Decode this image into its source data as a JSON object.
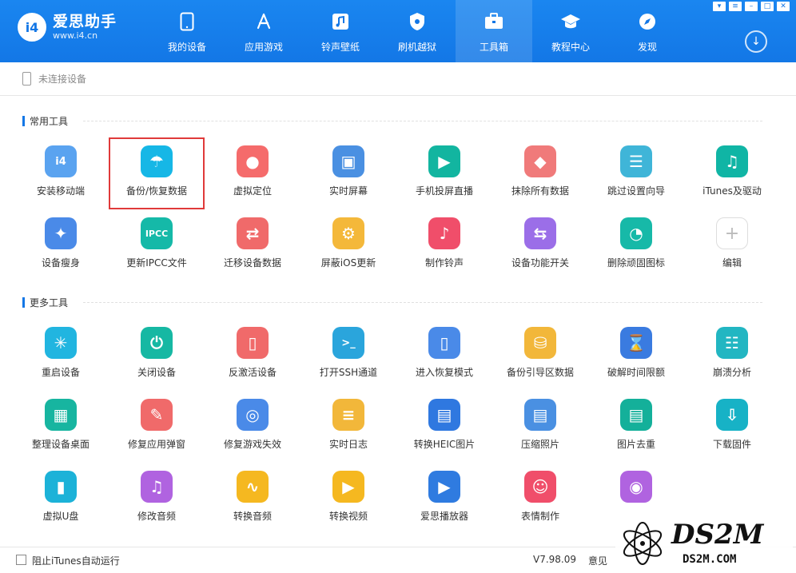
{
  "app": {
    "logo_mark": "i4",
    "logo_title": "爱思助手",
    "logo_url": "www.i4.cn"
  },
  "nav": [
    {
      "label": "我的设备",
      "icon": "phone-icon"
    },
    {
      "label": "应用游戏",
      "icon": "app-store-icon"
    },
    {
      "label": "铃声壁纸",
      "icon": "music-icon"
    },
    {
      "label": "刷机越狱",
      "icon": "shield-icon"
    },
    {
      "label": "工具箱",
      "icon": "toolbox-icon",
      "active": true
    },
    {
      "label": "教程中心",
      "icon": "graduation-cap-icon"
    },
    {
      "label": "发现",
      "icon": "compass-icon"
    }
  ],
  "device": {
    "status": "未连接设备"
  },
  "sections": {
    "common": "常用工具",
    "more": "更多工具"
  },
  "common_tools": [
    {
      "label": "安装移动端",
      "color": "#5aa3f0",
      "glyph": "i4"
    },
    {
      "label": "备份/恢复数据",
      "color": "#16b7e6",
      "glyph": "☂"
    },
    {
      "label": "虚拟定位",
      "color": "#f56b6b",
      "glyph": "●"
    },
    {
      "label": "实时屏幕",
      "color": "#4a90e2",
      "glyph": "▣"
    },
    {
      "label": "手机投屏直播",
      "color": "#12b5a0",
      "glyph": "▶"
    },
    {
      "label": "抹除所有数据",
      "color": "#f07a7a",
      "glyph": "◆"
    },
    {
      "label": "跳过设置向导",
      "color": "#3fb5d8",
      "glyph": "☰"
    },
    {
      "label": "iTunes及驱动",
      "color": "#10b5a5",
      "glyph": "♫"
    },
    {
      "label": "设备瘦身",
      "color": "#4a8ae8",
      "glyph": "✦"
    },
    {
      "label": "更新IPCC文件",
      "color": "#15b9a8",
      "glyph": "IPCC"
    },
    {
      "label": "迁移设备数据",
      "color": "#f06a6a",
      "glyph": "⇄"
    },
    {
      "label": "屏蔽iOS更新",
      "color": "#f4b83a",
      "glyph": "⚙"
    },
    {
      "label": "制作铃声",
      "color": "#f04e6a",
      "glyph": "♪"
    },
    {
      "label": "设备功能开关",
      "color": "#9b6ee8",
      "glyph": "⇆"
    },
    {
      "label": "删除顽固图标",
      "color": "#17b9a8",
      "glyph": "◔"
    },
    {
      "label": "编辑",
      "color": "#ffffff",
      "glyph": "+"
    }
  ],
  "more_tools": [
    {
      "label": "重启设备",
      "color": "#21b5e0",
      "glyph": "✳"
    },
    {
      "label": "关闭设备",
      "color": "#16b8a3",
      "glyph": "⏻"
    },
    {
      "label": "反激活设备",
      "color": "#f06a6a",
      "glyph": "▯"
    },
    {
      "label": "打开SSH通道",
      "color": "#2aa5dc",
      "glyph": ">_"
    },
    {
      "label": "进入恢复模式",
      "color": "#4a8ae8",
      "glyph": "▯"
    },
    {
      "label": "备份引导区数据",
      "color": "#f2b73a",
      "glyph": "⛁"
    },
    {
      "label": "破解时间限额",
      "color": "#3a7be0",
      "glyph": "⌛"
    },
    {
      "label": "崩溃分析",
      "color": "#22b6c2",
      "glyph": "☷"
    },
    {
      "label": "整理设备桌面",
      "color": "#17b5a0",
      "glyph": "▦"
    },
    {
      "label": "修复应用弹窗",
      "color": "#f06a6a",
      "glyph": "✎"
    },
    {
      "label": "修复游戏失效",
      "color": "#4a8ae8",
      "glyph": "◎"
    },
    {
      "label": "实时日志",
      "color": "#f2b73a",
      "glyph": "≡"
    },
    {
      "label": "转换HEIC图片",
      "color": "#2f78e0",
      "glyph": "▤"
    },
    {
      "label": "压缩照片",
      "color": "#4a90e2",
      "glyph": "▤"
    },
    {
      "label": "图片去重",
      "color": "#14b09a",
      "glyph": "▤"
    },
    {
      "label": "下载固件",
      "color": "#17b2c6",
      "glyph": "⇩"
    },
    {
      "label": "虚拟U盘",
      "color": "#1cb2d8",
      "glyph": "▮"
    },
    {
      "label": "修改音频",
      "color": "#b063e0",
      "glyph": "♫"
    },
    {
      "label": "转换音频",
      "color": "#f5b820",
      "glyph": "∿"
    },
    {
      "label": "转换视频",
      "color": "#f5b820",
      "glyph": "▶"
    },
    {
      "label": "爱思播放器",
      "color": "#2f7be0",
      "glyph": "▶"
    },
    {
      "label": "表情制作",
      "color": "#f04e6a",
      "glyph": "☺"
    },
    {
      "label": "",
      "color": "#b063e0",
      "glyph": "◉"
    }
  ],
  "footer": {
    "checkbox_label": "阻止iTunes自动运行",
    "version": "V7.98.09",
    "feedback": "意见"
  },
  "watermark": {
    "brand": "DS2M",
    "url": "DS2M.COM"
  }
}
